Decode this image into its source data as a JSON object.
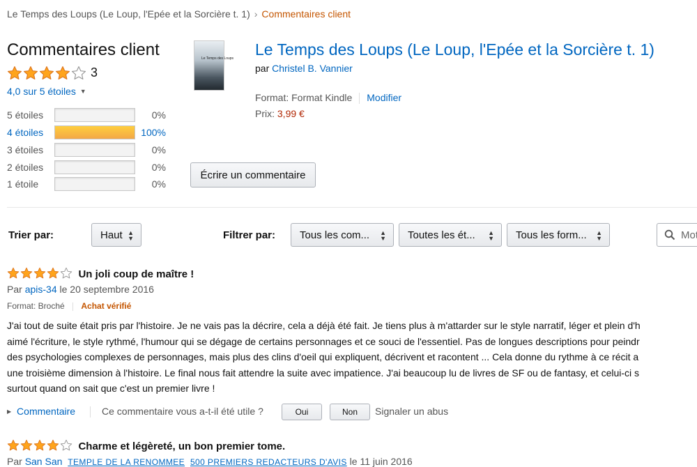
{
  "breadcrumb": {
    "product": "Le Temps des Loups (Le Loup, l'Epée et la Sorcière t. 1)",
    "separator": "›",
    "current": "Commentaires client"
  },
  "summary": {
    "title": "Commentaires client",
    "rating_stars": 4,
    "rating_count": "3",
    "average_label": "4,0 sur 5 étoiles",
    "histogram": [
      {
        "label": "5 étoiles",
        "pct_text": "0%",
        "fraction": 0.0
      },
      {
        "label": "4 étoiles",
        "pct_text": "100%",
        "fraction": 1.0
      },
      {
        "label": "3 étoiles",
        "pct_text": "0%",
        "fraction": 0.0
      },
      {
        "label": "2 étoiles",
        "pct_text": "0%",
        "fraction": 0.0
      },
      {
        "label": "1 étoile",
        "pct_text": "0%",
        "fraction": 0.0
      }
    ]
  },
  "product": {
    "cover_text": "Le Temps des Loups",
    "title": "Le Temps des Loups (Le Loup, l'Epée et la Sorcière t. 1)",
    "by": "par",
    "author": "Christel B. Vannier",
    "format_label": "Format: Format Kindle",
    "modify_label": "Modifier",
    "price_label": "Prix:",
    "price": "3,99 €",
    "write_review_label": "Écrire un commentaire"
  },
  "controls": {
    "sort_label": "Trier par:",
    "sort_value": "Haut",
    "filter_label": "Filtrer par:",
    "filter_reviewers": "Tous les com...",
    "filter_stars": "Toutes les ét...",
    "filter_formats": "Tous les form...",
    "search_placeholder": "Mot"
  },
  "reviews": [
    {
      "stars": 4,
      "title": "Un joli coup de maître !",
      "by": "Par",
      "author": "apis-34",
      "date": "le 20 septembre 2016",
      "format": "Format: Broché",
      "verified": "Achat vérifié",
      "body_lines": [
        "J'ai tout de suite était pris par l'histoire. Je ne vais pas la décrire, cela a déjà été fait. Je tiens plus à m'attarder sur le style narratif, léger et plein d'h",
        "aimé l'écriture, le style rythmé, l'humour qui se dégage de certains personnages et ce souci de l'essentiel. Pas de longues descriptions pour peindr",
        "des psychologies complexes de personnages, mais plus des clins d'oeil qui expliquent, décrivent et racontent ... Cela donne du rythme à ce récit a",
        "une troisième dimension à l'histoire. Le final nous fait attendre la suite avec impatience. J'ai beaucoup lu de livres de SF ou de fantasy, et celui-ci s",
        "surtout quand on sait que c'est un premier livre !"
      ],
      "comment_label": "Commentaire",
      "helpful_question": "Ce commentaire vous a-t-il été utile ?",
      "yes_label": "Oui",
      "no_label": "Non",
      "report_label": "Signaler un abus"
    },
    {
      "stars": 4,
      "title": "Charme et légèreté, un bon premier tome.",
      "by": "Par",
      "author": "San San",
      "badge": "TEMPLE DE LA RENOMMEE",
      "badge2": "500 PREMIERS REDACTEURS D'AVIS",
      "date": "le 11 juin 2016"
    }
  ],
  "colors": {
    "link": "#0066c0",
    "star": "#ffa41c",
    "accent_orange": "#c45500",
    "price": "#b12704"
  }
}
